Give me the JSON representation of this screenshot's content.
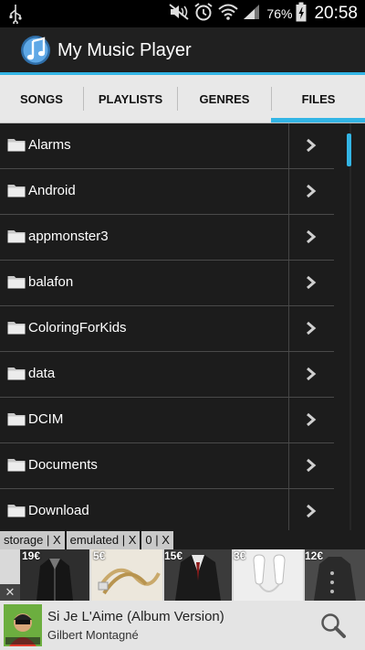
{
  "status_bar": {
    "battery_percent": "76%",
    "time": "20:58",
    "icons": [
      "usb-icon",
      "mute-icon",
      "alarm-icon",
      "wifi-icon",
      "signal-icon",
      "battery-icon"
    ]
  },
  "app": {
    "title": "My Music Player",
    "accent_color": "#33b5e5"
  },
  "tabs": [
    {
      "label": "SONGS",
      "selected": false
    },
    {
      "label": "PLAYLISTS",
      "selected": false
    },
    {
      "label": "GENRES",
      "selected": false
    },
    {
      "label": "FILES",
      "selected": true
    }
  ],
  "files": [
    {
      "name": "Alarms"
    },
    {
      "name": "Android"
    },
    {
      "name": "appmonster3"
    },
    {
      "name": "balafon"
    },
    {
      "name": "ColoringForKids"
    },
    {
      "name": "data"
    },
    {
      "name": "DCIM"
    },
    {
      "name": "Documents"
    },
    {
      "name": "Download"
    }
  ],
  "breadcrumb": [
    {
      "label": "storage | X"
    },
    {
      "label": "emulated | X"
    },
    {
      "label": "0 | X"
    }
  ],
  "ads": [
    {
      "price": "19€"
    },
    {
      "price": "5€"
    },
    {
      "price": "15€"
    },
    {
      "price": "3€"
    },
    {
      "price": "12€"
    }
  ],
  "ad_close": "✕",
  "now_playing": {
    "title": "Si Je L'Aime (Album Version)",
    "artist": "Gilbert Montagné"
  }
}
